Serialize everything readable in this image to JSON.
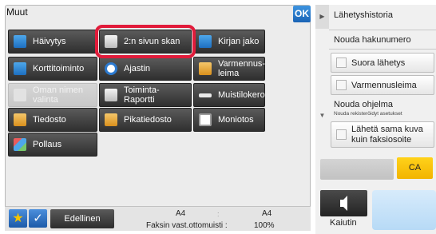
{
  "dialog": {
    "title": "Muut",
    "ok_label": "OK",
    "tiles": [
      {
        "name": "tile-hairline",
        "label": "Häivytys",
        "icon": "fade-icon",
        "enabled": true
      },
      {
        "name": "tile-two-page-scan",
        "label": "2:n sivun skan",
        "icon": "book-scan-icon",
        "enabled": true,
        "highlighted": true
      },
      {
        "name": "tile-book-divide",
        "label": "Kirjan jako",
        "icon": "book-split-icon",
        "enabled": true
      },
      {
        "name": "tile-card-shot",
        "label": "Korttitoiminto",
        "icon": "card-icon",
        "enabled": true
      },
      {
        "name": "tile-timer",
        "label": "Ajastin",
        "icon": "clock-icon",
        "enabled": true
      },
      {
        "name": "tile-verification-stamp",
        "label": "Varmennus-\nleima",
        "icon": "stamp-icon",
        "enabled": true
      },
      {
        "name": "tile-own-name",
        "label": "Oman nimen\nvalinta",
        "icon": "name-icon",
        "enabled": false
      },
      {
        "name": "tile-transaction-report",
        "label": "Toiminta-\nRaportti",
        "icon": "report-icon",
        "enabled": true
      },
      {
        "name": "tile-memory-box",
        "label": "Muistilokero",
        "icon": "memory-box-icon",
        "enabled": true
      },
      {
        "name": "tile-file",
        "label": "Tiedosto",
        "icon": "folder-icon",
        "enabled": true
      },
      {
        "name": "tile-quick-file",
        "label": "Pikatiedosto",
        "icon": "quick-file-icon",
        "enabled": true
      },
      {
        "name": "tile-multi-shot",
        "label": "Moniotos",
        "icon": "multishot-icon",
        "enabled": true
      },
      {
        "name": "tile-polling",
        "label": "Pollaus",
        "icon": "polling-icon",
        "enabled": true
      }
    ]
  },
  "bottom_bar": {
    "previous_label": "Edellinen",
    "paper_size_left": "A4",
    "paper_size_right": "A4",
    "separator": ":",
    "memory_label": "Faksin vast.ottomuisti :",
    "memory_value": "100%"
  },
  "right_panel": {
    "history_label": "Lähetyshistoria",
    "recall_number_label": "Nouda hakunumero",
    "direct_tx_label": "Suora lähetys",
    "verification_stamp_label": "Varmennusleima",
    "recall_program_label": "Nouda ohjelma",
    "recall_program_sub": "Nouda rekisteröidyt asetukset",
    "send_same_label": "Lähetä sama kuva\nkuin faksiosoite",
    "ca_label": "CA",
    "speaker_label": "Kaiutin"
  },
  "colors": {
    "accent_blue": "#1d6fc0",
    "highlight_red": "#e11b3a",
    "ca_yellow": "#f2b400",
    "tile_dark": "#2f2f2f"
  }
}
